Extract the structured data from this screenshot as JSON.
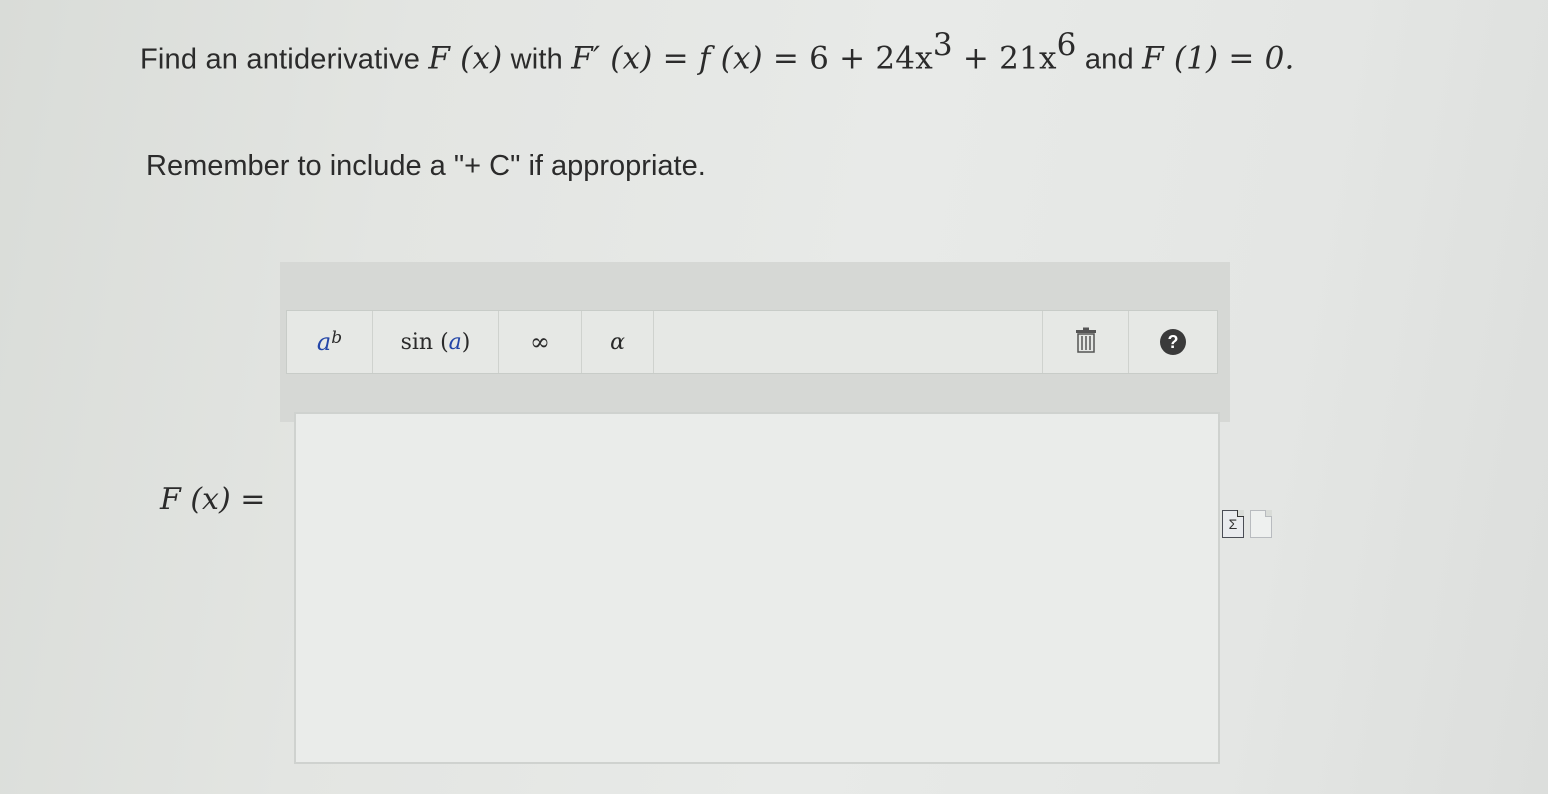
{
  "question": {
    "prefix": "Find an antiderivative ",
    "F_of_x": "F (x)",
    "with": " with ",
    "Fprime": "F′ (x)",
    "eq1": " = ",
    "f_of_x": "f (x)",
    "eq2": " = ",
    "expr_a": "6 + 24x",
    "exp_a": "3",
    "expr_b": " + 21x",
    "exp_b": "6",
    "and": " and ",
    "condition": "F (1) = 0."
  },
  "reminder": "Remember to include a \"+ C\" if appropriate.",
  "toolbar": {
    "power_base": "a",
    "power_exp": "b",
    "sin_prefix": "sin (",
    "sin_arg": "a",
    "sin_suffix": ")",
    "infinity": "∞",
    "alpha": "α",
    "help": "?"
  },
  "answer": {
    "label": "F (x) =",
    "value": ""
  },
  "icons": {
    "formula_preview": "Σ",
    "trash": "trash-icon",
    "help": "help-icon",
    "page": "page-icon"
  }
}
